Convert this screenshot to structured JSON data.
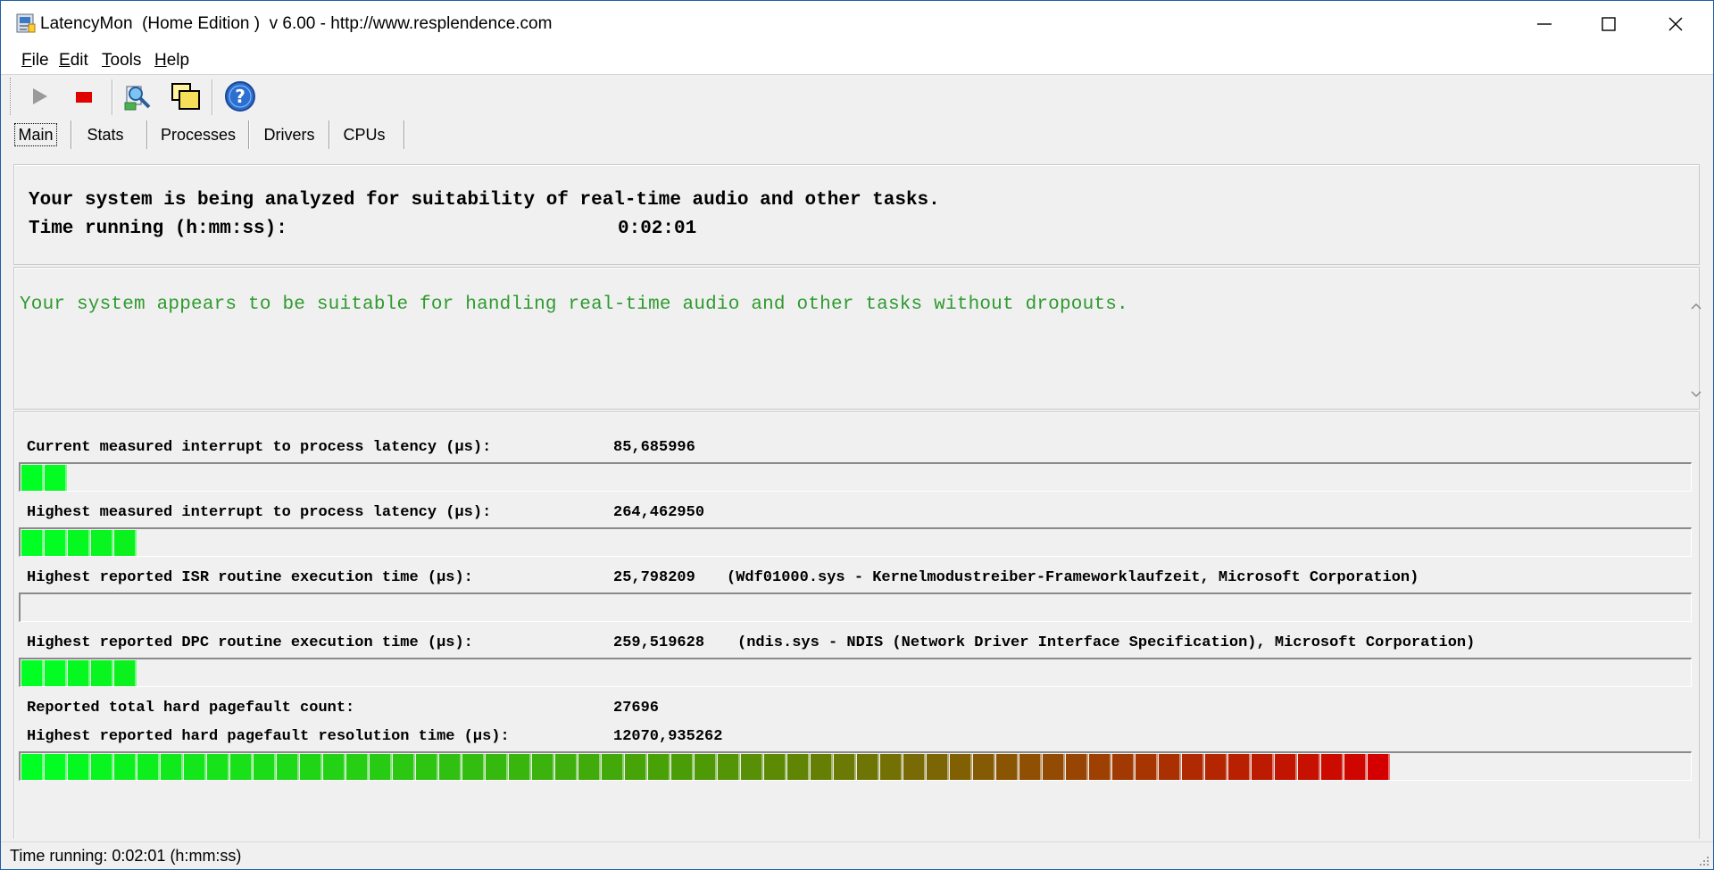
{
  "window": {
    "title": "LatencyMon  (Home Edition )  v 6.00 - http://www.resplendence.com",
    "icon": "latencymon-app-icon"
  },
  "menu": [
    {
      "label": "File",
      "accel": "F",
      "rest": "ile"
    },
    {
      "label": "Edit",
      "accel": "E",
      "rest": "dit"
    },
    {
      "label": "Tools",
      "accel": "T",
      "rest": "ools"
    },
    {
      "label": "Help",
      "accel": "H",
      "rest": "elp"
    }
  ],
  "toolbar": {
    "buttons": [
      "play-icon",
      "stop-icon",
      "analyze-icon",
      "windows-icon",
      "help-icon"
    ]
  },
  "tabs": [
    {
      "label": "Main",
      "active": true
    },
    {
      "label": "Stats",
      "active": false
    },
    {
      "label": "Processes",
      "active": false
    },
    {
      "label": "Drivers",
      "active": false
    },
    {
      "label": "CPUs",
      "active": false
    }
  ],
  "analysis": {
    "line1": "Your system is being analyzed for suitability of real-time audio and other tasks.",
    "time_label": "Time running (h:mm:ss):",
    "time_value": "0:02:01"
  },
  "conclusion": {
    "message": "Your system appears to be suitable for handling real-time audio and other tasks without dropouts.",
    "color": "#2e9a2e"
  },
  "metrics": {
    "current_latency": {
      "label": "Current measured interrupt to process latency (µs):",
      "value": "85,685996",
      "detail": "",
      "bar_segments": 2
    },
    "highest_latency": {
      "label": "Highest measured interrupt to process latency (µs):",
      "value": "264,462950",
      "detail": "",
      "bar_segments": 5
    },
    "isr": {
      "label": "Highest reported ISR routine execution time (µs):",
      "value": "25,798209",
      "detail": "(Wdf01000.sys - Kernelmodustreiber-Frameworklaufzeit, Microsoft Corporation)",
      "bar_segments": 0
    },
    "dpc": {
      "label": "Highest reported DPC routine execution time (µs):",
      "value": "259,519628",
      "detail": "(ndis.sys - NDIS (Network Driver Interface Specification), Microsoft Corporation)",
      "bar_segments": 5
    },
    "pagefault_count": {
      "label": "Reported total hard pagefault count:",
      "value": "27696"
    },
    "pagefault_time": {
      "label": "Highest reported hard pagefault resolution time (µs):",
      "value": "12070,935262",
      "detail": "",
      "bar_segments": 59
    }
  },
  "meter_colors": {
    "start": "#00ff22",
    "mid": "#4e9a06",
    "end": "#d40000"
  },
  "statusbar": {
    "text": "Time running: 0:02:01  (h:mm:ss)"
  }
}
